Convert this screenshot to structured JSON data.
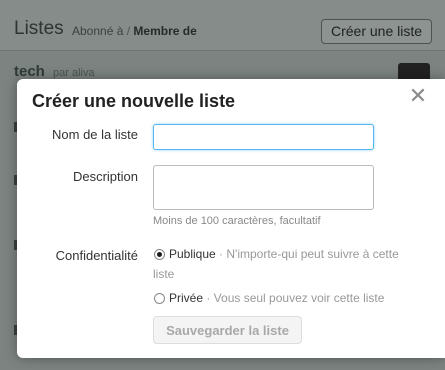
{
  "background": {
    "title": "Listes",
    "subtitle_following": "Abonné à",
    "subtitle_sep": "/",
    "subtitle_member": "Membre de",
    "create_button": "Créer une liste",
    "row": {
      "name": "tech",
      "by": "par aliva"
    }
  },
  "modal": {
    "title": "Créer une nouvelle liste",
    "close_glyph": "✕",
    "name_label": "Nom de la liste",
    "name_value": "",
    "description_label": "Description",
    "description_value": "",
    "description_hint": "Moins de 100 caractères, facultatif",
    "privacy_label": "Confidentialité",
    "public_label": "Publique",
    "public_desc": " · N'importe-qui peut suivre à cette liste",
    "private_label": "Privée",
    "private_desc": " · Vous seul pouvez voir cette liste",
    "save_button": "Sauvegarder la liste"
  },
  "colors": {
    "focus_border": "#56b4ef",
    "overlay": "#7c8381"
  },
  "icons": {
    "close": "close-icon"
  }
}
